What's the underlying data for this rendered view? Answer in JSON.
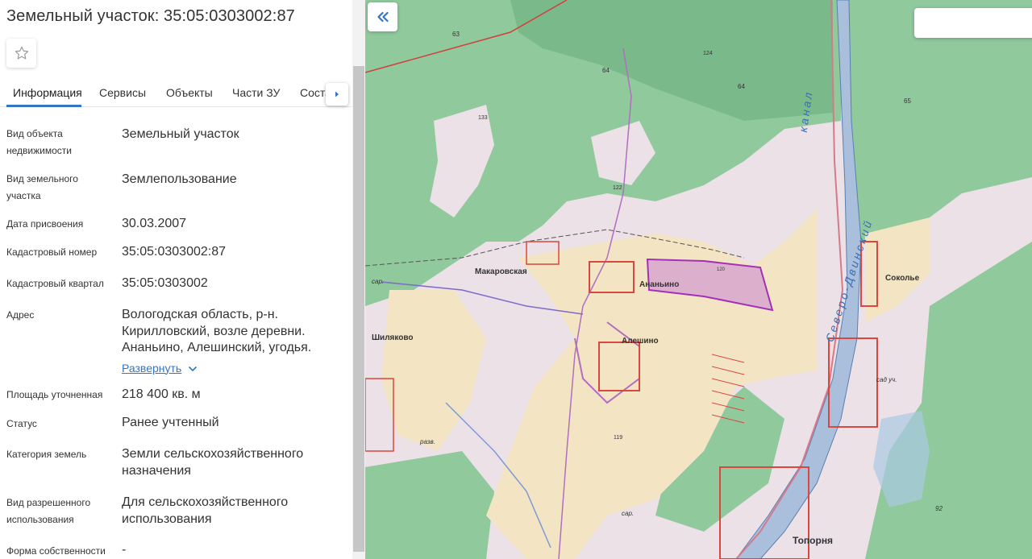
{
  "title": "Земельный участок: 35:05:0303002:87",
  "favorite_icon": "star-outline-icon",
  "tabs": [
    "Информация",
    "Сервисы",
    "Объекты",
    "Части ЗУ",
    "Соста"
  ],
  "tabs_active": "Информация",
  "tabs_scroll_icon": "chevron-right-icon",
  "info": [
    {
      "label": "Вид объекта недвижимости",
      "value": "Земельный участок"
    },
    {
      "label": "Вид земельного участка",
      "value": "Землепользование"
    },
    {
      "label": "Дата присвоения",
      "value": "30.03.2007"
    },
    {
      "label": "Кадастровый номер",
      "value": "35:05:0303002:87"
    },
    {
      "label": "Кадастровый квартал",
      "value": "35:05:0303002"
    },
    {
      "label": "Адрес",
      "value": "Вологодская область, р-н. Кирилловский, возле деревни. Ананьино, Алешинский, угодья.",
      "expand_label": "Развернуть"
    },
    {
      "label": "Площадь уточненная",
      "value": "218 400 кв. м"
    },
    {
      "label": "Статус",
      "value": "Ранее учтенный"
    },
    {
      "label": "Категория земель",
      "value": "Земли сельскохозяйственного назначения"
    },
    {
      "label": "Вид разрешенного использования",
      "value": "Для сельскохозяйственного использования"
    },
    {
      "label": "Форма собственности",
      "value": "-"
    }
  ],
  "map": {
    "collapse_icon": "double-chevron-left-icon",
    "search_value": "",
    "place_labels": [
      "Макаровская",
      "Ананьино",
      "Алешино",
      "Шиляково",
      "Сокольe",
      "Топорня",
      "Северо-Двинский",
      "канал"
    ],
    "small_labels": [
      "63",
      "64",
      "64",
      "124",
      "65",
      "133",
      "122",
      "120",
      "сар.",
      "разв.",
      "сад уч.",
      "92",
      "сар.",
      "119"
    ],
    "colors": {
      "forest": "#8fc99c",
      "forest_dark": "#7ab98a",
      "field": "#f3e4c3",
      "meadow": "#e9e0e5",
      "canal": "#a9bfdc",
      "parcel_highlight": "#a230b8",
      "settlement": "#d9473f"
    }
  }
}
